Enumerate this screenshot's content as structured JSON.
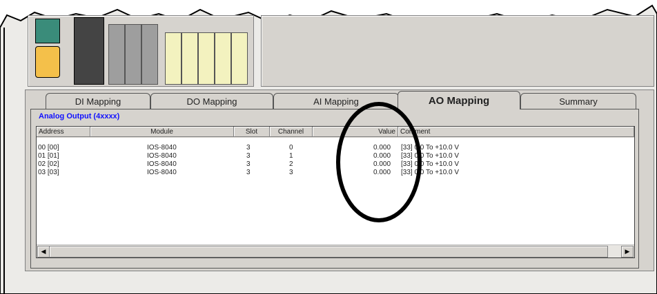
{
  "tabs": [
    {
      "label": "DI Mapping",
      "active": false
    },
    {
      "label": "DO Mapping",
      "active": false
    },
    {
      "label": "AI Mapping",
      "active": false
    },
    {
      "label": "AO Mapping",
      "active": true
    },
    {
      "label": "Summary",
      "active": false
    }
  ],
  "section_title": "Analog Output  (4xxxx)",
  "columns": [
    "Address",
    "Module",
    "Slot",
    "Channel",
    "Value",
    "Comment"
  ],
  "rows": [
    {
      "address": "00 [00]",
      "module": "IOS-8040",
      "slot": "3",
      "channel": "0",
      "value": "0.000",
      "comment": "[33] 0.0 To +10.0 V"
    },
    {
      "address": "01 [01]",
      "module": "IOS-8040",
      "slot": "3",
      "channel": "1",
      "value": "0.000",
      "comment": "[33] 0.0 To +10.0 V"
    },
    {
      "address": "02 [02]",
      "module": "IOS-8040",
      "slot": "3",
      "channel": "2",
      "value": "0.000",
      "comment": "[33] 0.0 To +10.0 V"
    },
    {
      "address": "03 [03]",
      "module": "IOS-8040",
      "slot": "3",
      "channel": "3",
      "value": "0.000",
      "comment": "[33] 0.0 To +10.0 V"
    }
  ],
  "colors": {
    "section_title": "#1010ff",
    "background": "#d6d3ce"
  }
}
